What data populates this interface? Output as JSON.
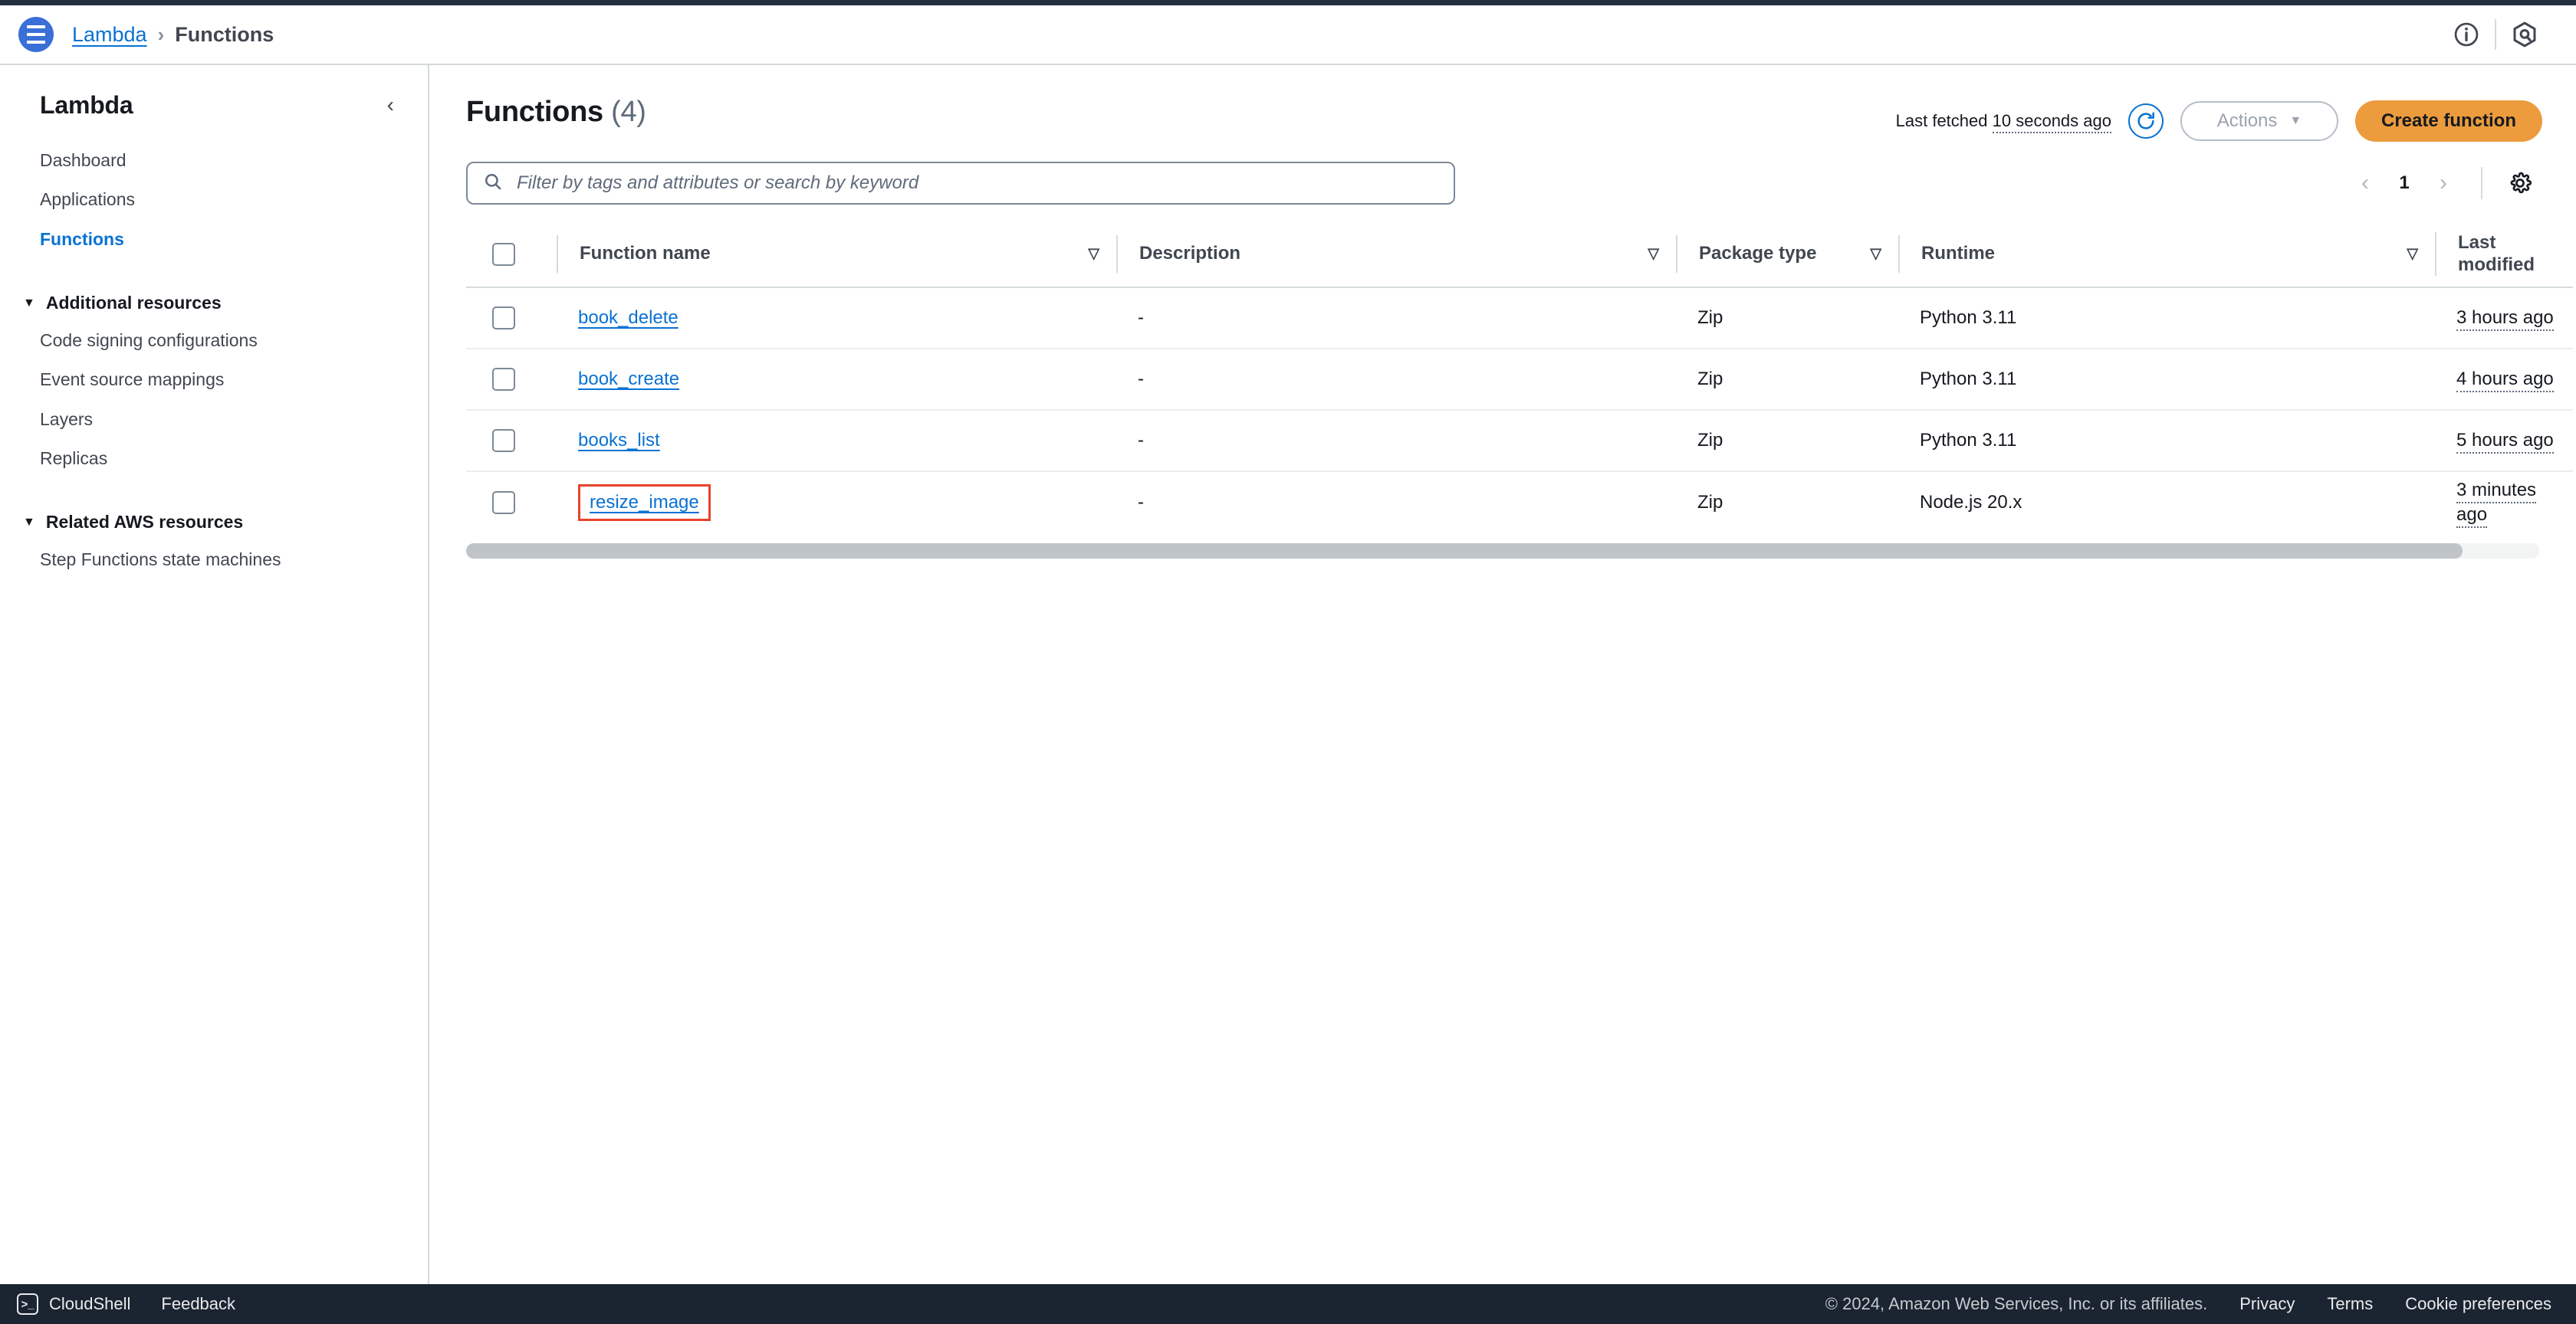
{
  "header": {
    "menu_icon": "hamburger-menu-icon",
    "breadcrumb": {
      "root_label": "Lambda",
      "separator": "›",
      "current_label": "Functions"
    },
    "info_icon": "info-circle-icon",
    "amazon_q_icon": "amazon-q-hexagon-icon"
  },
  "sidebar": {
    "title": "Lambda",
    "collapse_icon": "‹",
    "items": [
      {
        "label": "Dashboard",
        "active": false
      },
      {
        "label": "Applications",
        "active": false
      },
      {
        "label": "Functions",
        "active": true
      }
    ],
    "groups": [
      {
        "label": "Additional resources",
        "caret": "▼",
        "items": [
          {
            "label": "Code signing configurations"
          },
          {
            "label": "Event source mappings"
          },
          {
            "label": "Layers"
          },
          {
            "label": "Replicas"
          }
        ]
      },
      {
        "label": "Related AWS resources",
        "caret": "▼",
        "items": [
          {
            "label": "Step Functions state machines"
          }
        ]
      }
    ]
  },
  "main": {
    "page_title": "Functions",
    "page_count": "(4)",
    "last_fetched_prefix": "Last fetched",
    "last_fetched_value": "10 seconds ago",
    "refresh_icon": "refresh-icon",
    "actions_label": "Actions",
    "actions_caret": "▼",
    "create_label": "Create function",
    "search_placeholder": "Filter by tags and attributes or search by keyword",
    "search_value": "",
    "search_icon": "search-icon",
    "pagination": {
      "prev_icon": "‹",
      "page": "1",
      "next_icon": "›"
    },
    "settings_icon": "gear-icon",
    "table": {
      "select_all_label": "select-all-checkbox",
      "sort_icon": "▽",
      "columns": [
        {
          "label": "Function name",
          "sortable": true
        },
        {
          "label": "Description",
          "sortable": true
        },
        {
          "label": "Package type",
          "sortable": true
        },
        {
          "label": "Runtime",
          "sortable": true
        },
        {
          "label": "Last modified",
          "sortable": false
        }
      ],
      "rows": [
        {
          "name": "book_delete",
          "description": "-",
          "package_type": "Zip",
          "runtime": "Python 3.11",
          "last_modified": "3 hours ago",
          "highlighted": false
        },
        {
          "name": "book_create",
          "description": "-",
          "package_type": "Zip",
          "runtime": "Python 3.11",
          "last_modified": "4 hours ago",
          "highlighted": false
        },
        {
          "name": "books_list",
          "description": "-",
          "package_type": "Zip",
          "runtime": "Python 3.11",
          "last_modified": "5 hours ago",
          "highlighted": false
        },
        {
          "name": "resize_image",
          "description": "-",
          "package_type": "Zip",
          "runtime": "Node.js 20.x",
          "last_modified": "3 minutes ago",
          "highlighted": true
        }
      ]
    }
  },
  "footer": {
    "cloudshell_label": "CloudShell",
    "cloudshell_icon": "terminal-icon",
    "feedback_label": "Feedback",
    "copyright": "© 2024, Amazon Web Services, Inc. or its affiliates.",
    "links": [
      {
        "label": "Privacy"
      },
      {
        "label": "Terms"
      },
      {
        "label": "Cookie preferences"
      }
    ]
  },
  "colors": {
    "accent_blue": "#0972d3",
    "brand_orange": "#ec9c3d",
    "highlight_red": "#e8432a",
    "dark_navy": "#1b2431",
    "top_strip": "#232f3e"
  }
}
